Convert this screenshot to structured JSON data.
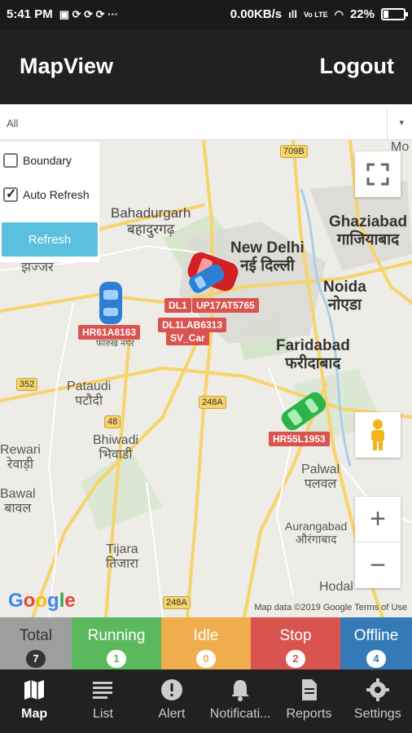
{
  "status_bar": {
    "time": "5:41 PM",
    "speed": "0.00KB/s",
    "battery": "22%",
    "network": "Vo LTE"
  },
  "app": {
    "title": "MapView",
    "logout": "Logout"
  },
  "filter": {
    "selected": "All"
  },
  "map_controls": {
    "boundary_label": "Boundary",
    "boundary_checked": false,
    "auto_refresh_label": "Auto Refresh",
    "auto_refresh_checked": true,
    "refresh_button": "Refresh"
  },
  "map": {
    "places": {
      "bahadurgarh": "Bahadurgarh",
      "bahadurgarh_hi": "बहादुरगढ़",
      "new_delhi": "New Delhi",
      "new_delhi_hi": "नई दिल्ली",
      "ghaziabad": "Ghaziabad",
      "ghaziabad_hi": "गाजियाबाद",
      "noida": "Noida",
      "noida_hi": "नोएडा",
      "faridabad": "Faridabad",
      "faridabad_hi": "फरीदाबाद",
      "jhajjar_hi": "झज्जर",
      "pataudi": "Pataudi",
      "pataudi_hi": "पटौदी",
      "bhiwadi": "Bhiwadi",
      "bhiwadi_hi": "भिवाडी",
      "rewari": "Rewari",
      "rewari_hi": "रेवाड़ी",
      "palwal": "Palwal",
      "palwal_hi": "पलवल",
      "bawal": "Bawal",
      "bawal_hi": "बावल",
      "aurangabad": "Aurangabad",
      "aurangabad_hi": "औरंगाबाद",
      "tijara": "Tijara",
      "tijara_hi": "तिजारा",
      "hodal": "Hodal",
      "farrukhnagar_hi": "फारुख नगर",
      "mo": "Mo"
    },
    "shields": [
      "709B",
      "352",
      "48",
      "248A",
      "248A"
    ],
    "vehicles": [
      {
        "label": "HR61A8163",
        "color": "#2d7fd3"
      },
      {
        "label": "DL1",
        "color": "#d42020"
      },
      {
        "label": "UP17AT5765",
        "color": "#d42020"
      },
      {
        "label": "DL1LAB6313",
        "color": "#d42020"
      },
      {
        "label": "SV_Car",
        "color": "#d42020"
      },
      {
        "label": "HR55L1953",
        "color": "#2db34a"
      }
    ],
    "logo": "Google",
    "attribution": "Map data ©2019 Google   Terms of Use"
  },
  "status_tiles": [
    {
      "label": "Total",
      "count": "7",
      "color": "#9e9e9e"
    },
    {
      "label": "Running",
      "count": "1",
      "color": "#5cb85c"
    },
    {
      "label": "Idle",
      "count": "0",
      "color": "#f0ad4e"
    },
    {
      "label": "Stop",
      "count": "2",
      "color": "#d9534f"
    },
    {
      "label": "Offline",
      "count": "4",
      "color": "#337ab7"
    }
  ],
  "nav": [
    {
      "label": "Map",
      "icon": "map-icon"
    },
    {
      "label": "List",
      "icon": "list-icon"
    },
    {
      "label": "Alert",
      "icon": "alert-icon"
    },
    {
      "label": "Notificati...",
      "icon": "bell-icon"
    },
    {
      "label": "Reports",
      "icon": "reports-icon"
    },
    {
      "label": "Settings",
      "icon": "gear-icon"
    }
  ]
}
